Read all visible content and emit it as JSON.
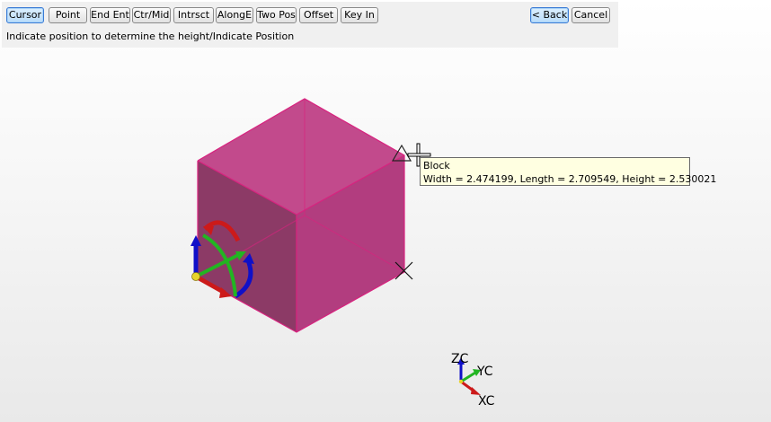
{
  "toolbar": {
    "buttons": [
      "Cursor",
      "Point",
      "End Ent",
      "Ctr/Mid",
      "Intrsct",
      "AlongE",
      "Two Pos",
      "Offset",
      "Key In"
    ],
    "back_label": "< Back",
    "cancel_label": "Cancel",
    "prompt": "Indicate position to determine the height/Indicate Position"
  },
  "tooltip": {
    "title": "Block",
    "detail": "Width = 2.474199, Length = 2.709549, Height = 2.530021"
  },
  "axes": {
    "z": "ZC",
    "y": "YC",
    "x": "XC"
  },
  "colors": {
    "block_left": "#8c3a66",
    "block_right": "#b23d7f",
    "block_top": "#c24a8c",
    "block_edge": "#d8237f",
    "manip_x": "#cc1a1a",
    "manip_y": "#22b522",
    "manip_z": "#1010c8",
    "tooltip_bg": "#ffffe1"
  }
}
